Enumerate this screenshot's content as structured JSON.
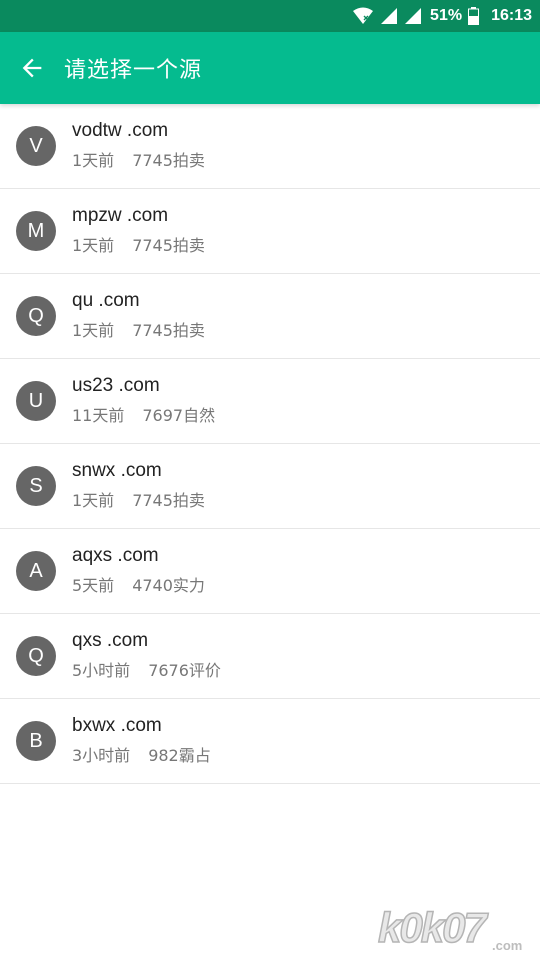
{
  "status_bar": {
    "battery_percent": "51%",
    "time": "16:13"
  },
  "app_bar": {
    "title": "请选择一个源"
  },
  "sources": [
    {
      "initial": "V",
      "name": "vodtw .com",
      "time": "1天前",
      "info": "7745拍卖"
    },
    {
      "initial": "M",
      "name": "mpzw .com",
      "time": "1天前",
      "info": "7745拍卖"
    },
    {
      "initial": "Q",
      "name": "qu .com",
      "time": "1天前",
      "info": "7745拍卖"
    },
    {
      "initial": "U",
      "name": "us23 .com",
      "time": "11天前",
      "info": "7697自然"
    },
    {
      "initial": "S",
      "name": "snwx .com",
      "time": "1天前",
      "info": "7745拍卖"
    },
    {
      "initial": "A",
      "name": "aqxs .com",
      "time": "5天前",
      "info": "4740实力"
    },
    {
      "initial": "Q",
      "name": "qxs .com",
      "time": "5小时前",
      "info": "7676评价"
    },
    {
      "initial": "B",
      "name": "bxwx .com",
      "time": "3小时前",
      "info": "982霸占"
    }
  ],
  "watermark": {
    "text": "k0k07",
    "suffix": ".com"
  },
  "colors": {
    "status_bar": "#0a8a5e",
    "app_bar": "#05bb8f",
    "avatar": "#666666"
  }
}
